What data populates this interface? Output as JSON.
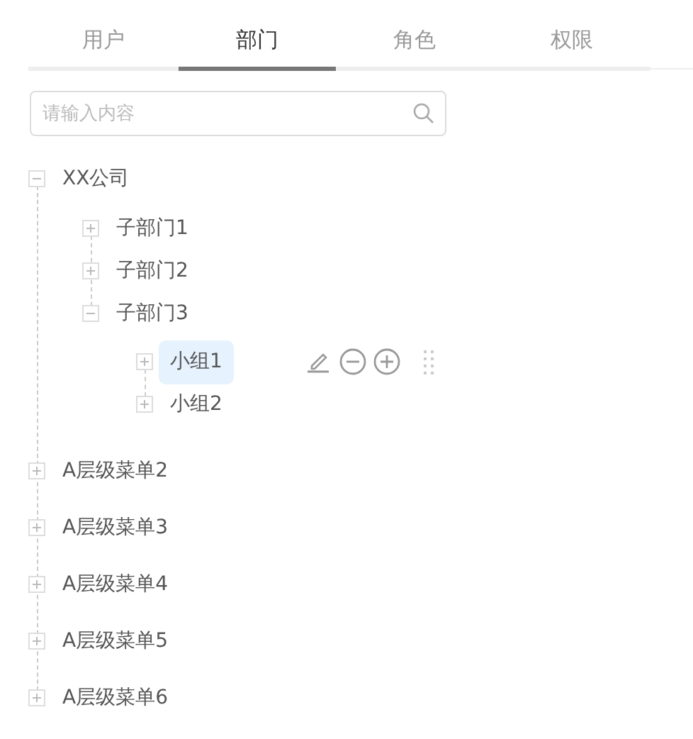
{
  "tabs": [
    {
      "label": "用户",
      "selected": false
    },
    {
      "label": "部门",
      "selected": true
    },
    {
      "label": "角色",
      "selected": false
    },
    {
      "label": "权限",
      "selected": false
    }
  ],
  "search": {
    "placeholder": "请输入内容"
  },
  "tree": [
    {
      "label": "XX公司",
      "expanded": true,
      "selected": false,
      "children": [
        {
          "label": "子部门1",
          "expanded": false,
          "selected": false
        },
        {
          "label": "子部门2",
          "expanded": false,
          "selected": false
        },
        {
          "label": "子部门3",
          "expanded": true,
          "selected": false,
          "children": [
            {
              "label": "小组1",
              "expanded": false,
              "selected": true
            },
            {
              "label": "小组2",
              "expanded": false,
              "selected": false
            }
          ]
        }
      ]
    },
    {
      "label": "A层级菜单2",
      "expanded": false,
      "selected": false
    },
    {
      "label": "A层级菜单3",
      "expanded": false,
      "selected": false
    },
    {
      "label": "A层级菜单4",
      "expanded": false,
      "selected": false
    },
    {
      "label": "A层级菜单5",
      "expanded": false,
      "selected": false
    },
    {
      "label": "A层级菜单6",
      "expanded": false,
      "selected": false
    }
  ]
}
